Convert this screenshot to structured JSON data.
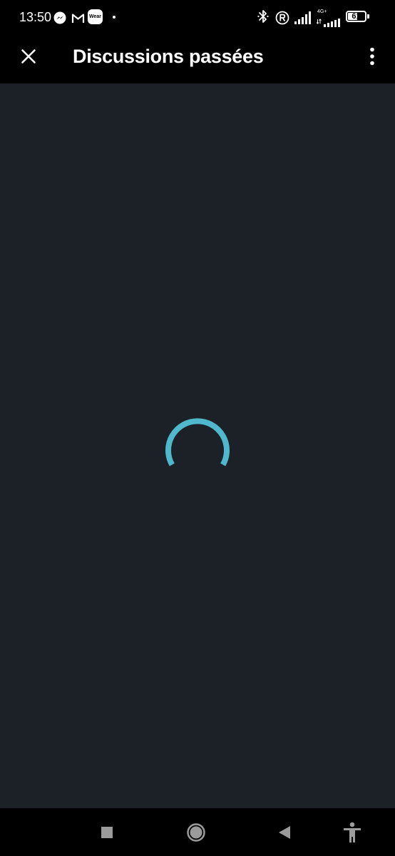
{
  "status_bar": {
    "time": "13:50",
    "wear_label": "Wear",
    "network_label": "4G+",
    "battery_level": "61",
    "battery_fraction": 0.61,
    "icons": [
      "messenger-icon",
      "gmail-icon",
      "wear-os-icon",
      "bluetooth-icon",
      "roaming-r-icon",
      "signal-icon",
      "battery-icon"
    ]
  },
  "app_bar": {
    "title": "Discussions passées",
    "close_icon": "close-icon",
    "menu_icon": "more-vert-icon"
  },
  "content": {
    "state": "loading",
    "spinner_color": "#4fb8cc"
  },
  "nav_bar": {
    "icons": [
      "recents-square-icon",
      "home-circle-icon",
      "back-triangle-icon",
      "accessibility-icon"
    ]
  },
  "colors": {
    "background": "#1c2128",
    "bars": "#000000",
    "accent": "#4fb8cc"
  }
}
